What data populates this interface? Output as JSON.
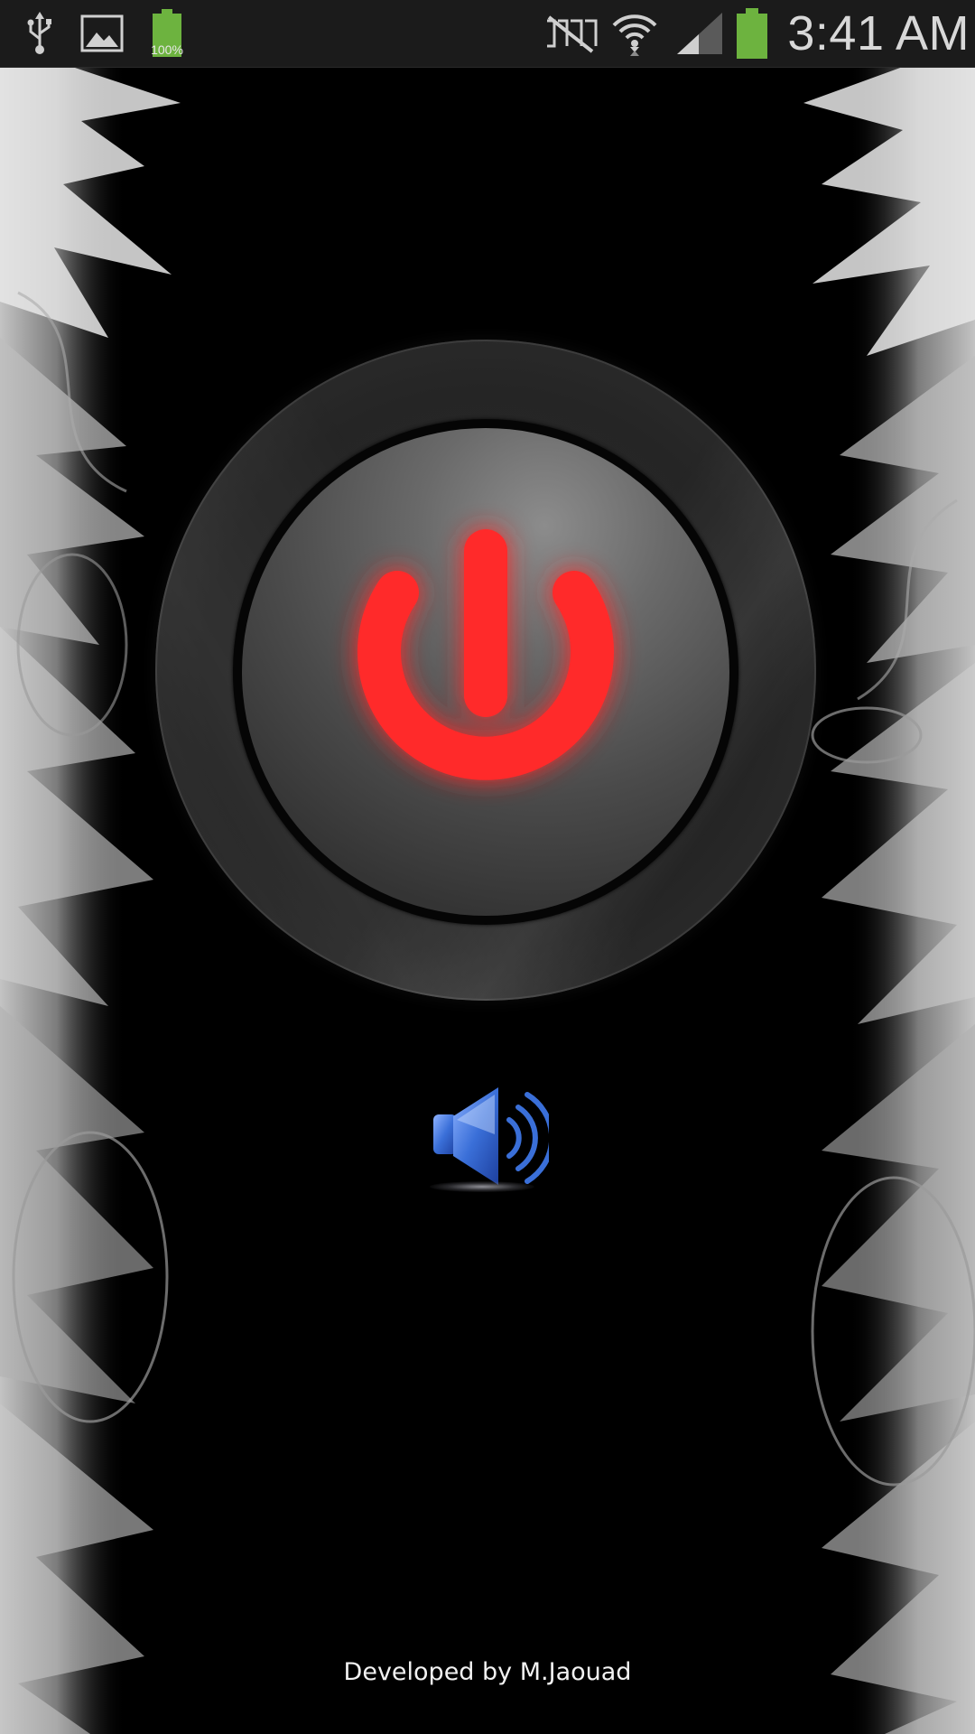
{
  "status_bar": {
    "time": "3:41 AM",
    "notification_battery_label": "100%",
    "icons": [
      "usb-icon",
      "gallery-icon",
      "battery-notification-icon",
      "no-signal-icon",
      "wifi-icon",
      "cell-signal-icon",
      "battery-icon"
    ],
    "battery_color": "#6db33f"
  },
  "main": {
    "power_button": {
      "icon": "power-icon",
      "color": "#ff2b2b"
    },
    "sound_button": {
      "icon": "speaker-icon",
      "color": "#3a6fd8"
    }
  },
  "footer": {
    "credit": "Developed by M.Jaouad"
  }
}
